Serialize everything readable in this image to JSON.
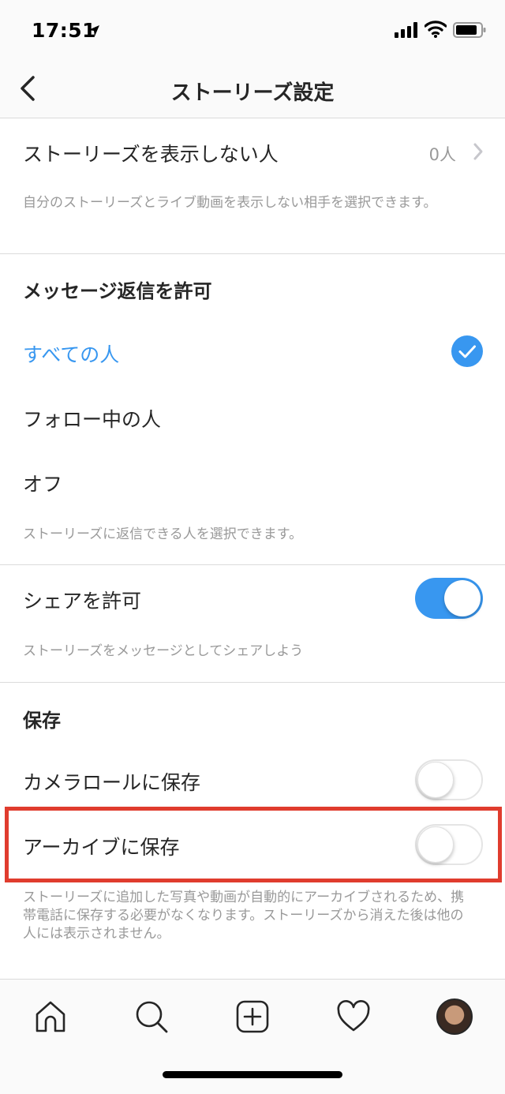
{
  "status_bar": {
    "time": "17:51"
  },
  "header": {
    "title": "ストーリーズ設定",
    "back_icon": "chevron-left-icon"
  },
  "hide_story": {
    "label": "ストーリーズを表示しない人",
    "count": "0人",
    "description": "自分のストーリーズとライブ動画を表示しない相手を選択できます。"
  },
  "message_replies": {
    "title": "メッセージ返信を許可",
    "options": [
      {
        "label": "すべての人",
        "selected": true
      },
      {
        "label": "フォロー中の人",
        "selected": false
      },
      {
        "label": "オフ",
        "selected": false
      }
    ],
    "description": "ストーリーズに返信できる人を選択できます。"
  },
  "sharing": {
    "label": "シェアを許可",
    "enabled": true,
    "description": "ストーリーズをメッセージとしてシェアしよう"
  },
  "saving": {
    "title": "保存",
    "camera_roll": {
      "label": "カメラロールに保存",
      "enabled": false
    },
    "archive": {
      "label": "アーカイブに保存",
      "enabled": false
    },
    "description": "ストーリーズに追加した写真や動画が自動的にアーカイブされるため、携帯電話に保存する必要がなくなります。ストーリーズから消えた後は他の人には表示されません。"
  },
  "tab_bar": {
    "items": [
      "home-icon",
      "search-icon",
      "add-post-icon",
      "activity-heart-icon",
      "profile-avatar"
    ]
  },
  "colors": {
    "accent": "#3897f0",
    "highlight": "#e03c2e",
    "secondary_text": "#999999",
    "primary_text": "#262626"
  }
}
